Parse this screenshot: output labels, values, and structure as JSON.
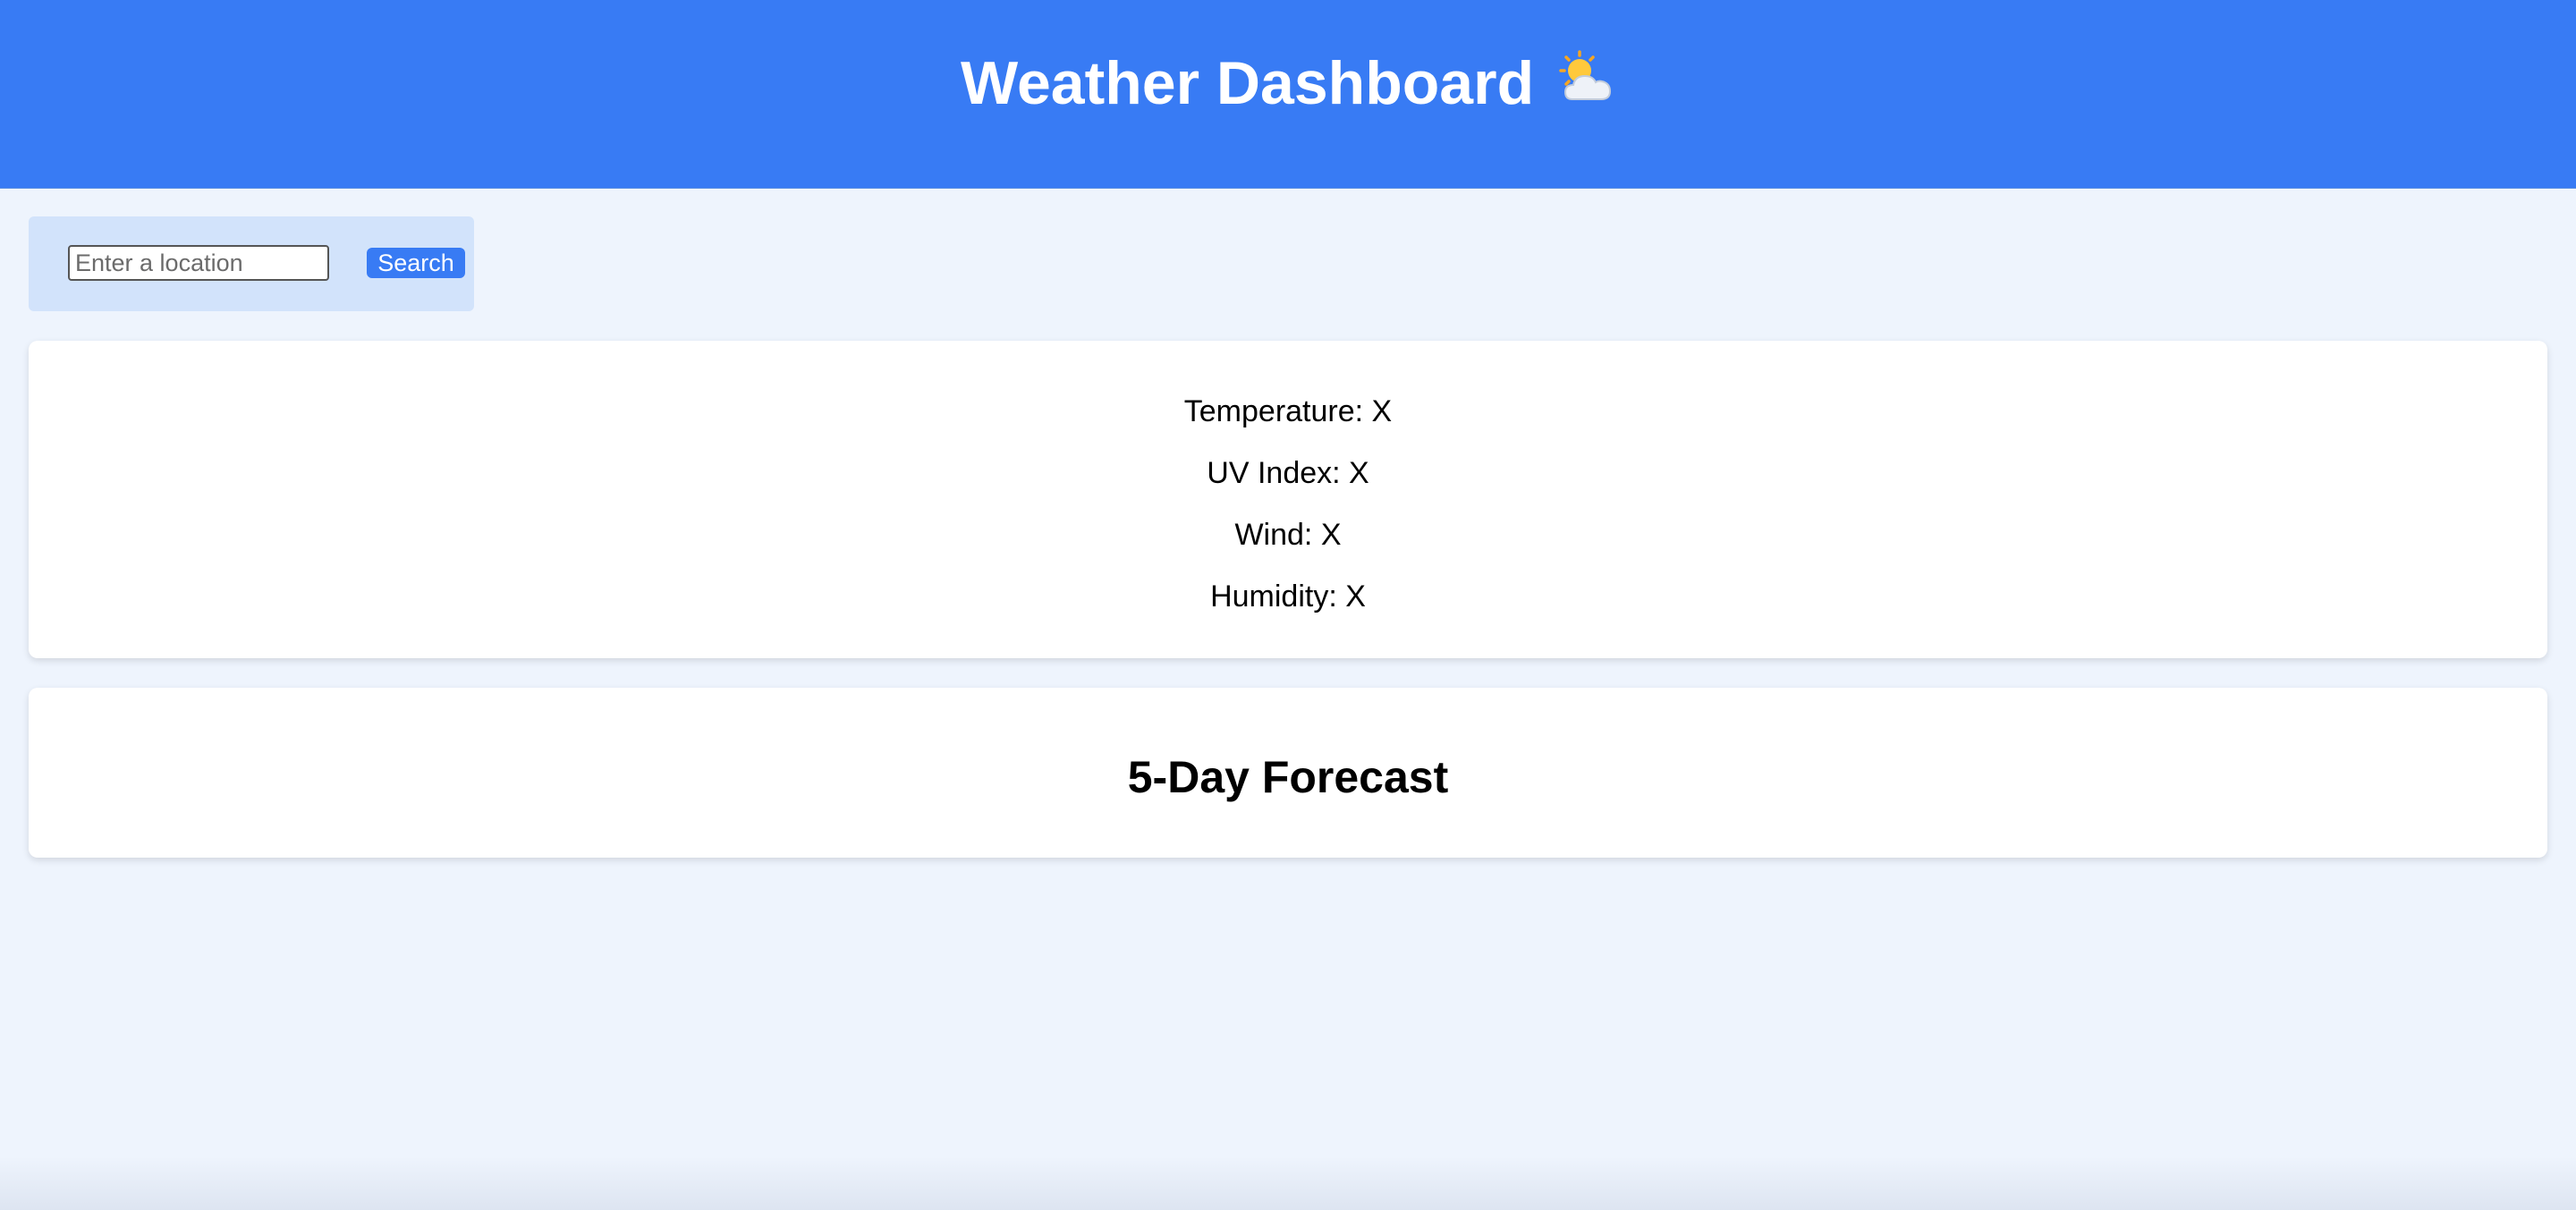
{
  "header": {
    "title": "Weather Dashboard",
    "icon": "sun-behind-cloud-icon",
    "background_color": "#387bf4"
  },
  "search": {
    "placeholder": "Enter a location",
    "value": "",
    "button_label": "Search"
  },
  "current_weather": {
    "temperature": "Temperature: X",
    "uv_index": "UV Index: X",
    "wind": "Wind: X",
    "humidity": "Humidity: X"
  },
  "forecast": {
    "title": "5-Day Forecast"
  },
  "colors": {
    "accent": "#387bf4",
    "page_background": "#eef4fd",
    "search_panel": "#d2e3fb",
    "card": "#ffffff"
  }
}
